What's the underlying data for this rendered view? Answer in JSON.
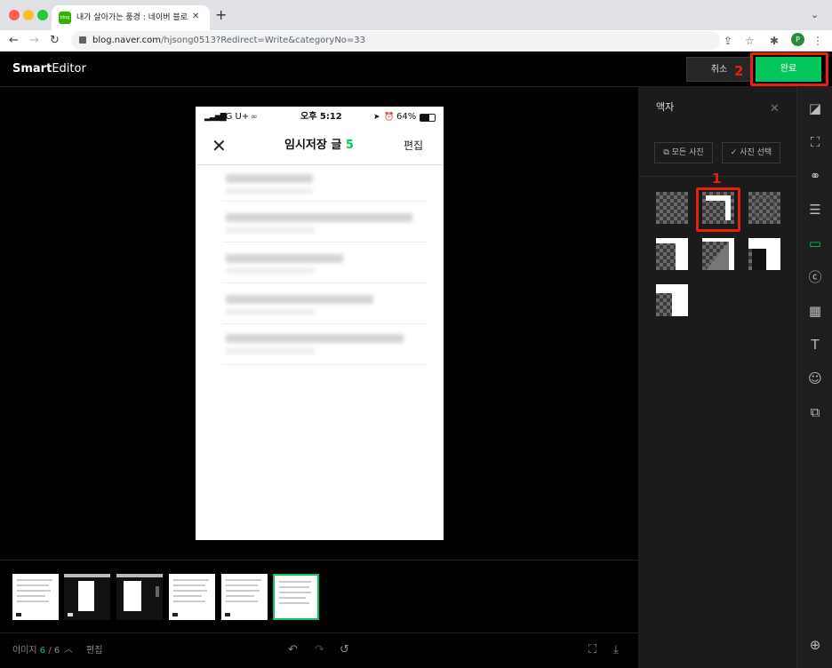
{
  "browser": {
    "tab_title": "내가 살아가는 풍경 : 네이버 블로그",
    "favicon_text": "blog",
    "url_host": "blog.naver.com",
    "url_path": "/hjsong0513?Redirect=Write&categoryNo=33",
    "profile_initial": "P",
    "new_tab": "+",
    "tab_close": "✕"
  },
  "editor": {
    "logo_bold": "Smart",
    "logo_light": "Editor",
    "cancel_label": "취소",
    "done_label": "완료"
  },
  "annotations": {
    "one": "1",
    "two": "2"
  },
  "phone": {
    "carrier": "LG U+",
    "time": "오후 5:12",
    "battery": "64%",
    "header_title": "임시저장 글",
    "header_count": "5",
    "edit_label": "편집",
    "close_icon": "✕"
  },
  "bottom": {
    "image_label": "이미지",
    "current": "6",
    "separator": "/",
    "total": "6",
    "edit_label": "편집"
  },
  "panel": {
    "title": "액자",
    "all_photos": "모든 사진",
    "select_photo": "사진 선택"
  },
  "colors": {
    "accent": "#03c75a",
    "annotation": "#e8200c"
  }
}
